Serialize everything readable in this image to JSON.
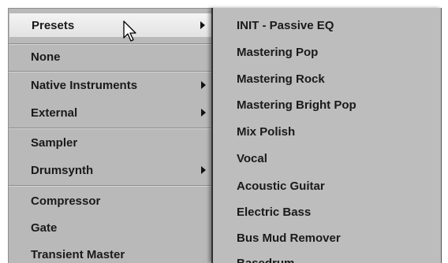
{
  "left_menu": {
    "items": [
      {
        "label": "Presets",
        "submenu": true
      },
      {
        "label": "None",
        "submenu": false
      },
      {
        "label": "Native Instruments",
        "submenu": true
      },
      {
        "label": "External",
        "submenu": true
      },
      {
        "label": "Sampler",
        "submenu": false
      },
      {
        "label": "Drumsynth",
        "submenu": true
      },
      {
        "label": "Compressor",
        "submenu": false
      },
      {
        "label": "Gate",
        "submenu": false
      },
      {
        "label": "Transient Master",
        "submenu": false
      }
    ],
    "highlighted": "Presets"
  },
  "submenu": {
    "items": [
      "INIT - Passive EQ",
      "Mastering Pop",
      "Mastering Rock",
      "Mastering Bright Pop",
      "Mix Polish",
      "Vocal",
      "Acoustic Guitar",
      "Electric Bass",
      "Bus Mud Remover",
      "Basedrum"
    ]
  },
  "icons": {
    "cursor": "mouse-pointer-icon",
    "submenu_arrow": "chevron-right-icon"
  },
  "colors": {
    "menu_background": "#b9b9b9",
    "highlight": "#ececec",
    "text": "#1a1a1a"
  }
}
